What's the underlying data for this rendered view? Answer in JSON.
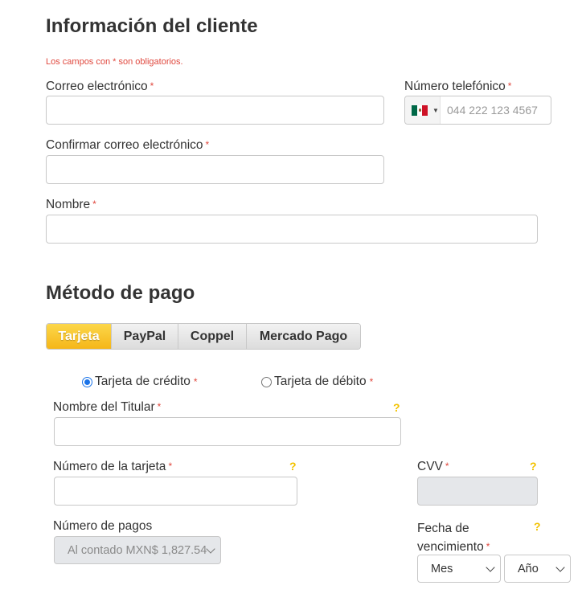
{
  "customer": {
    "title": "Información del cliente",
    "required_note": "Los campos con * son obligatorios.",
    "email_label": "Correo electrónico",
    "phone_label": "Número telefónico",
    "phone_placeholder": "044 222 123 4567",
    "confirm_email_label": "Confirmar correo electrónico",
    "name_label": "Nombre",
    "required_mark": "*"
  },
  "payment": {
    "title": "Método de pago",
    "tabs": [
      {
        "label": "Tarjeta",
        "active": true
      },
      {
        "label": "PayPal",
        "active": false
      },
      {
        "label": "Coppel",
        "active": false
      },
      {
        "label": "Mercado Pago",
        "active": false
      }
    ],
    "card_types": [
      {
        "label": "Tarjeta de crédito",
        "checked": true
      },
      {
        "label": "Tarjeta de débito",
        "checked": false
      }
    ],
    "holder_label": "Nombre del Titular",
    "card_number_label": "Número de la tarjeta",
    "cvv_label": "CVV",
    "payments_label": "Número de pagos",
    "payments_value": "Al contado MXN$ 1,827.54",
    "expiry_label_line1": "Fecha de",
    "expiry_label_line2": "vencimiento",
    "month_value": "Mes",
    "year_value": "Año",
    "help_glyph": "?"
  },
  "icons": {
    "flag": "mexico-flag-icon",
    "help": "question-mark-icon",
    "dropdown": "chevron-down-icon"
  },
  "colors": {
    "accent": "#f5b619",
    "required": "#e0483e",
    "help": "#f2c200",
    "radio": "#1a73e8"
  }
}
